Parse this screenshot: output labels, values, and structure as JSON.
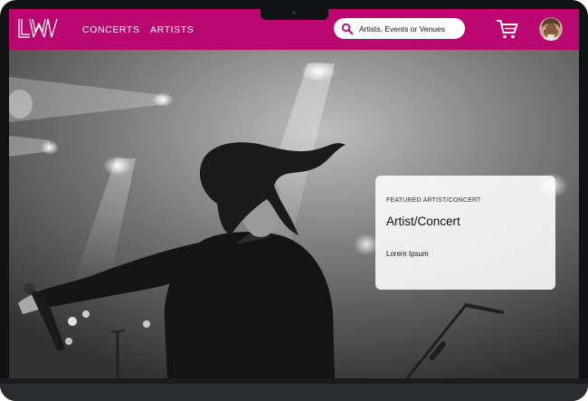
{
  "header": {
    "logo_text": "LW",
    "nav": [
      {
        "label": "CONCERTS"
      },
      {
        "label": "ARTISTS"
      }
    ],
    "search": {
      "placeholder": "Artists, Events or Venues"
    },
    "icons": {
      "search": "search-icon",
      "cart": "shopping-cart-icon",
      "avatar": "user-avatar"
    }
  },
  "featured_card": {
    "eyebrow": "FEATURED ARTIST/CONCERT",
    "title": "Artist/Concert",
    "body": "Lorem Ipsum"
  },
  "colors": {
    "brand": "#b9076f",
    "device_frame": "#111214",
    "card_bg": "#ffffff"
  }
}
